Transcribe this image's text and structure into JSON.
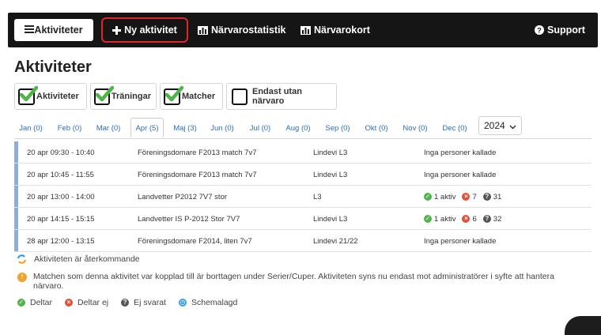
{
  "nav": {
    "activities": "Aktiviteter",
    "new_activity": "Ny aktivitet",
    "attendance_stats": "Närvarostatistik",
    "attendance_card": "Närvarokort",
    "support": "Support"
  },
  "page": {
    "title": "Aktiviteter"
  },
  "filters": {
    "activities": "Aktiviteter",
    "trainings": "Träningar",
    "matches": "Matcher",
    "only_without_attendance": "Endast utan närvaro"
  },
  "months": [
    "Jan (0)",
    "Feb (0)",
    "Mar (0)",
    "Apr (5)",
    "Maj (3)",
    "Jun (0)",
    "Jul (0)",
    "Aug (0)",
    "Sep (0)",
    "Okt (0)",
    "Nov (0)",
    "Dec (0)"
  ],
  "active_month": "Apr (5)",
  "year_select": {
    "value": "2024"
  },
  "activities": [
    {
      "time": "20 apr 09:30 - 10:40",
      "name": "Föreningsdomare F2013 match 7v7",
      "place": "Lindevi L3",
      "status_text": "Inga personer kallade"
    },
    {
      "time": "20 apr 10:45 - 11:55",
      "name": "Föreningsdomare F2013 match 7v7",
      "place": "Lindevi L3",
      "status_text": "Inga personer kallade"
    },
    {
      "time": "20 apr 13:00 - 14:00",
      "name": "Landvetter P2012 7V7 stor",
      "place": "L3",
      "active": "1 aktiv",
      "declined": "7",
      "unanswered": "31"
    },
    {
      "time": "20 apr 14:15 - 15:15",
      "name": "Landvetter IS P-2012 Stor 7V7",
      "place": "Lindevi L3",
      "active": "1 aktiv",
      "declined": "6",
      "unanswered": "32"
    },
    {
      "time": "28 apr 12:00 - 13:15",
      "name": "Föreningsdomare F2014, liten 7v7",
      "place": "Lindevi 21/22",
      "status_text": "Inga personer kallade"
    }
  ],
  "notes": {
    "recurring": "Aktiviteten är återkommande",
    "removed_match": "Matchen som denna aktivitet var kopplad till är borttagen under Serier/Cuper. Aktiviteten syns nu endast mot administratörer i syfte att hantera närvaro."
  },
  "legend": {
    "participating": "Deltar",
    "not_participating": "Deltar ej",
    "not_answered": "Ej svarat",
    "scheduled": "Schemalagd"
  },
  "colors": {
    "navbar": "#151515",
    "highlight_border": "#e0262c",
    "check_green": "#4fb54a",
    "link_blue": "#2a6fb8"
  }
}
